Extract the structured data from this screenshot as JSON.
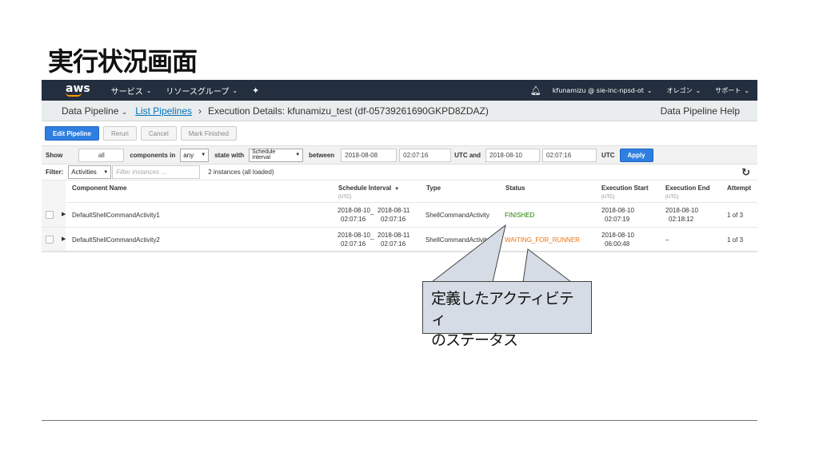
{
  "slide": {
    "title": "実行状況画面",
    "callout_line1": "定義したアクティビティ",
    "callout_line2": "のステータス"
  },
  "topbar": {
    "logo": "aws",
    "services": "サービス",
    "resource_groups": "リソースグループ",
    "pin_icon": "pin-icon",
    "bell_icon": "bell-icon",
    "account": "kfunamizu @ sie-inc-npsd-ot",
    "region": "オレゴン",
    "support": "サポート"
  },
  "breadcrumb": {
    "service": "Data Pipeline",
    "list": "List Pipelines",
    "sep": "›",
    "current": "Execution Details: kfunamizu_test (df-05739261690GKPD8ZDAZ)",
    "help": "Data Pipeline Help"
  },
  "actions": {
    "edit": "Edit Pipeline",
    "rerun": "Rerun",
    "cancel": "Cancel",
    "mark_finished": "Mark Finished"
  },
  "filter": {
    "show_label": "Show",
    "show_value": "all",
    "components_in_label": "components in",
    "components_in_value": "any",
    "state_with_label": "state with",
    "state_with_value": "Schedule Interval",
    "between_label": "between",
    "start_date": "2018-08-08",
    "start_time": "02:07:16",
    "utc_and_label": "UTC and",
    "end_date": "2018-08-10",
    "end_time": "02:07:16",
    "utc_label": "UTC",
    "apply": "Apply",
    "filter_label": "Filter:",
    "filter_type": "Activities",
    "filter_placeholder": "Filter instances ...",
    "instances_count": "2 instances (all loaded)"
  },
  "table": {
    "headers": {
      "component_name": "Component Name",
      "schedule_interval": "Schedule Interval",
      "schedule_interval_sub": "(UTC)",
      "type": "Type",
      "status": "Status",
      "execution_start": "Execution Start",
      "execution_start_sub": "(UTC)",
      "execution_end": "Execution End",
      "execution_end_sub": "(UTC)",
      "attempt": "Attempt"
    },
    "rows": [
      {
        "name": "DefaultShellCommandActivity1",
        "sched_start_date": "2018-08-10",
        "sched_start_time": "02:07:16",
        "dash": "–",
        "sched_end_date": "2018-08-11",
        "sched_end_time": "02:07:16",
        "type": "ShellCommandActivity",
        "status": "FINISHED",
        "exec_start_date": "2018-08-10",
        "exec_start_time": "02:07:19",
        "exec_end_date": "2018-08-10",
        "exec_end_time": "02:18:12",
        "attempt": "1 of 3"
      },
      {
        "name": "DefaultShellCommandActivity2",
        "sched_start_date": "2018-08-10",
        "sched_start_time": "02:07:16",
        "dash": "–",
        "sched_end_date": "2018-08-11",
        "sched_end_time": "02:07:16",
        "type": "ShellCommandActivity",
        "status": "WAITING_FOR_RUNNER",
        "exec_start_date": "2018-08-10",
        "exec_start_time": "06:00:48",
        "exec_end": "–",
        "attempt": "1 of 3"
      }
    ]
  }
}
